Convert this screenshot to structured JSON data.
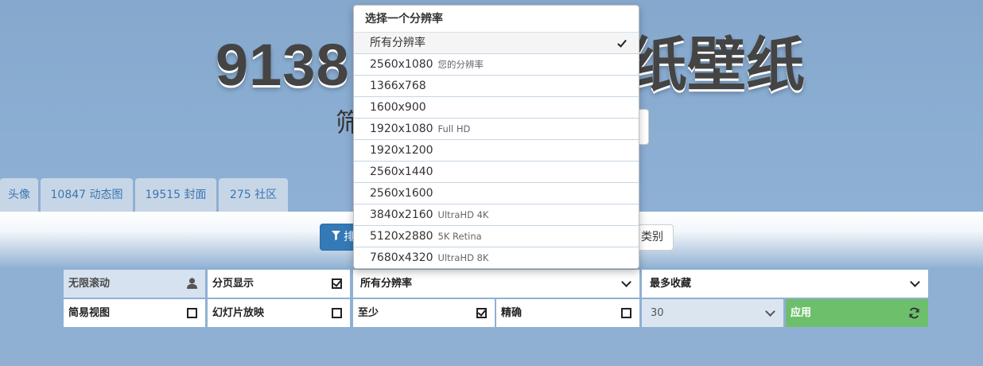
{
  "header": {
    "title_left": "9138",
    "title_right": "纸壁纸",
    "subtitle": "筛"
  },
  "tabs": [
    {
      "label": "头像"
    },
    {
      "label": "10847 动态图"
    },
    {
      "label": "19515 封面"
    },
    {
      "label": "275 社区"
    }
  ],
  "toolbar": {
    "sort_label": "排",
    "category_label": "类别"
  },
  "filters": {
    "row1": {
      "infinite_scroll": "无限滚动",
      "pagination": "分页显示",
      "resolution_select": "所有分辨率",
      "sort_select": "最多收藏"
    },
    "row2": {
      "simple_view": "简易视图",
      "slideshow": "幻灯片放映",
      "at_least": "至少",
      "exact": "精确",
      "per_page": "30",
      "apply": "应用"
    }
  },
  "dropdown": {
    "header": "选择一个分辨率",
    "items": [
      {
        "label": "所有分辨率",
        "sub": "",
        "selected": true
      },
      {
        "label": "2560x1080",
        "sub": "您的分辨率"
      },
      {
        "label": "1366x768",
        "sub": ""
      },
      {
        "label": "1600x900",
        "sub": ""
      },
      {
        "label": "1920x1080",
        "sub": "Full HD"
      },
      {
        "label": "1920x1200",
        "sub": ""
      },
      {
        "label": "2560x1440",
        "sub": ""
      },
      {
        "label": "2560x1600",
        "sub": ""
      },
      {
        "label": "3840x2160",
        "sub": "UltraHD 4K"
      },
      {
        "label": "5120x2880",
        "sub": "5K Retina"
      },
      {
        "label": "7680x4320",
        "sub": "UltraHD 8K"
      }
    ]
  },
  "icons": {
    "user": "user-icon",
    "refresh": "refresh-icon",
    "funnel": "filter-icon",
    "check": "check-icon",
    "chevron": "chevron-down-icon"
  }
}
